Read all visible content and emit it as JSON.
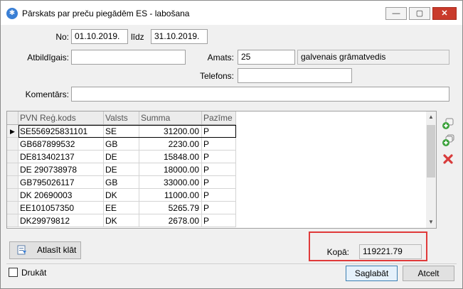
{
  "window": {
    "title": "Pārskats par preču piegādēm ES - labošana",
    "min_glyph": "—",
    "max_glyph": "▢",
    "close_glyph": "✕"
  },
  "form": {
    "no_label": "No:",
    "no_value": "01.10.2019.",
    "lidz_label": "līdz",
    "lidz_value": "31.10.2019.",
    "atbildigais_label": "Atbildīgais:",
    "atbildigais_value": "",
    "amats_label": "Amats:",
    "amats_code": "25",
    "amats_name": "galvenais grāmatvedis",
    "telefons_label": "Telefons:",
    "telefons_value": "",
    "komentars_label": "Komentārs:",
    "komentars_value": ""
  },
  "grid": {
    "headers": [
      "PVN Reģ.kods",
      "Valsts",
      "Summa",
      "Pazīme"
    ],
    "rows": [
      {
        "pvn": "SE556925831101",
        "valsts": "SE",
        "summa": "31200.00",
        "pazime": "P"
      },
      {
        "pvn": "GB687899532",
        "valsts": "GB",
        "summa": "2230.00",
        "pazime": "P"
      },
      {
        "pvn": "DE813402137",
        "valsts": "DE",
        "summa": "15848.00",
        "pazime": "P"
      },
      {
        "pvn": "DE 290738978",
        "valsts": "DE",
        "summa": "18000.00",
        "pazime": "P"
      },
      {
        "pvn": "GB795026117",
        "valsts": "GB",
        "summa": "33000.00",
        "pazime": "P"
      },
      {
        "pvn": "DK 20690003",
        "valsts": "DK",
        "summa": "11000.00",
        "pazime": "P"
      },
      {
        "pvn": "EE101057350",
        "valsts": "EE",
        "summa": "5265.79",
        "pazime": "P"
      },
      {
        "pvn": "DK29979812",
        "valsts": "DK",
        "summa": "2678.00",
        "pazime": "P"
      }
    ],
    "selected_row": 0,
    "row_indicator": "▶"
  },
  "side_icons": [
    "add-icon",
    "add-copy-icon",
    "delete-icon"
  ],
  "bottom": {
    "atlasit_label": "Atlasīt klāt",
    "kopa_label": "Kopā:",
    "kopa_value": "119221.79",
    "druka_label": "Drukāt",
    "druka_checked": false,
    "saglabat_label": "Saglabāt",
    "atcelt_label": "Atcelt"
  },
  "colors": {
    "highlight_box": "#e03a3a",
    "close_button": "#c93b2c"
  }
}
